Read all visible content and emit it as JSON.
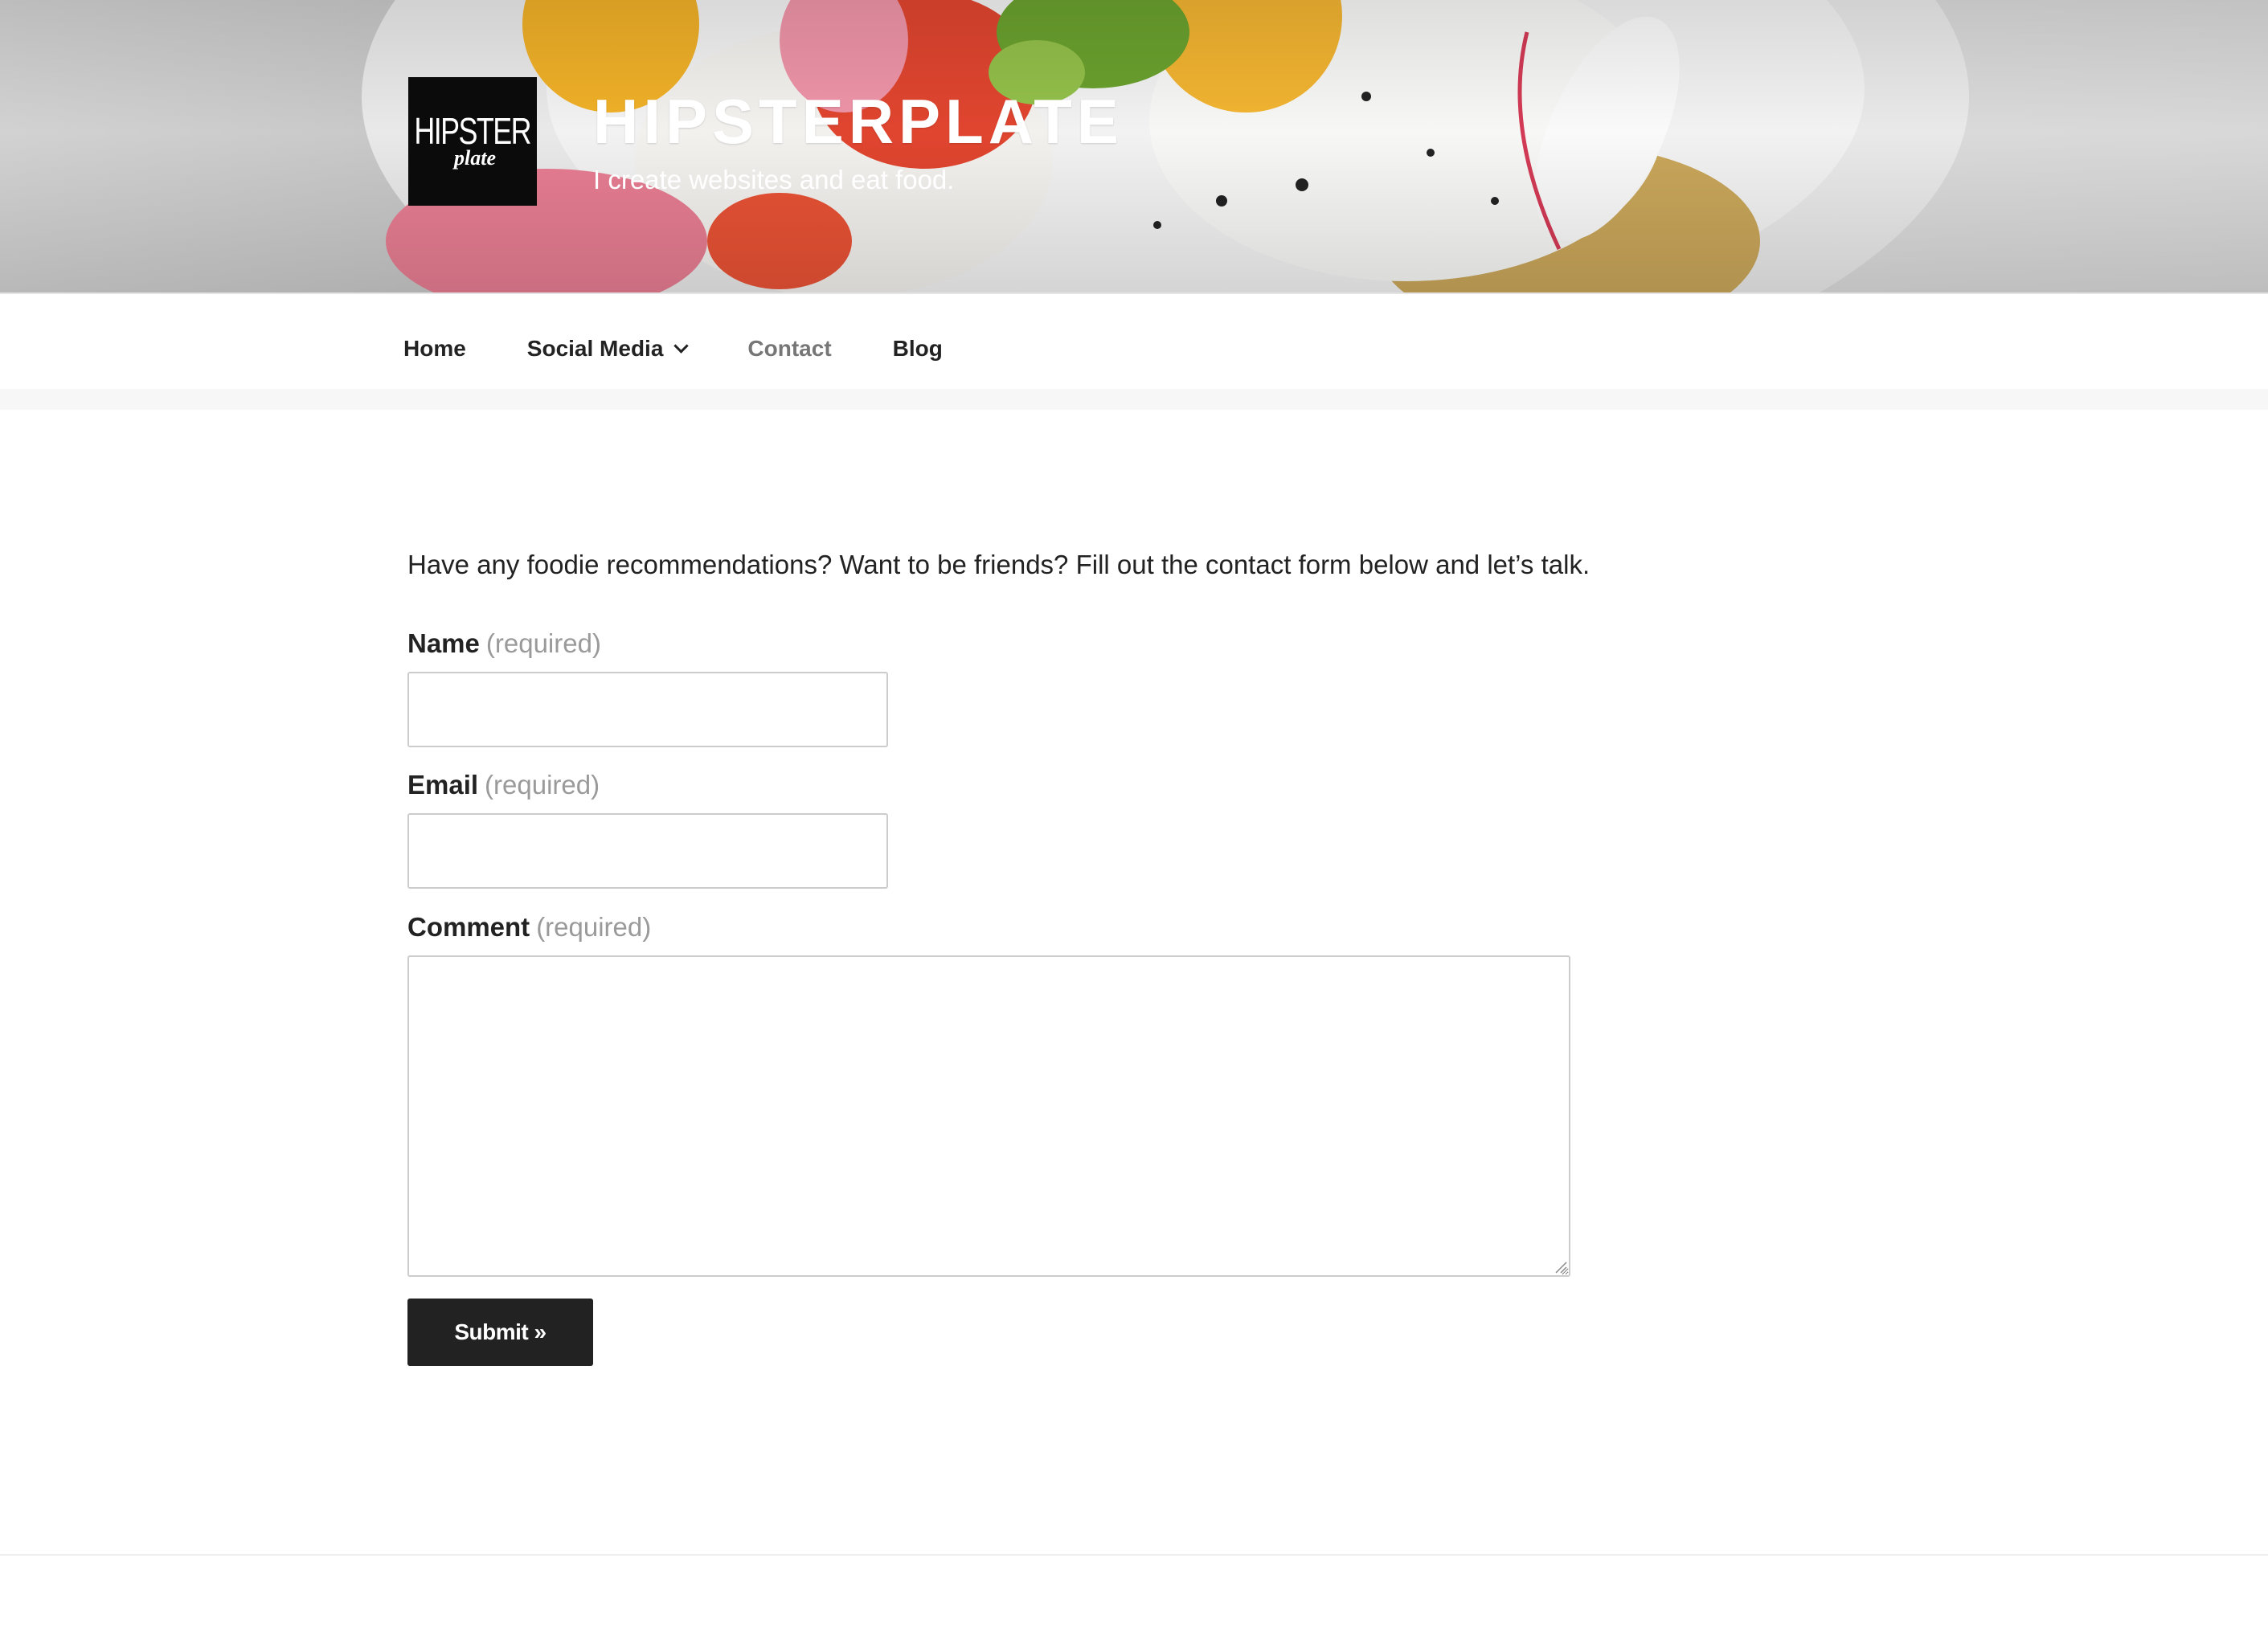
{
  "site": {
    "logo_word": "HIPSTER",
    "logo_script": "plate",
    "title": "HIPSTERPLATE",
    "tagline": "I create websites and eat food."
  },
  "nav": {
    "items": [
      {
        "label": "Home",
        "has_dropdown": false,
        "current": false
      },
      {
        "label": "Social Media",
        "has_dropdown": true,
        "current": false
      },
      {
        "label": "Contact",
        "has_dropdown": false,
        "current": true
      },
      {
        "label": "Blog",
        "has_dropdown": false,
        "current": false
      }
    ]
  },
  "contact": {
    "intro": "Have any foodie recommendations? Want to be friends? Fill out the contact form below and let’s talk.",
    "name_label": "Name",
    "email_label": "Email",
    "comment_label": "Comment",
    "required_note": "(required)",
    "name_value": "",
    "email_value": "",
    "comment_value": "",
    "submit_label": "Submit »"
  },
  "colors": {
    "text": "#222222",
    "muted": "#767676",
    "required": "#9a9a9a",
    "button_bg": "#222222",
    "input_border": "#cccccc"
  }
}
